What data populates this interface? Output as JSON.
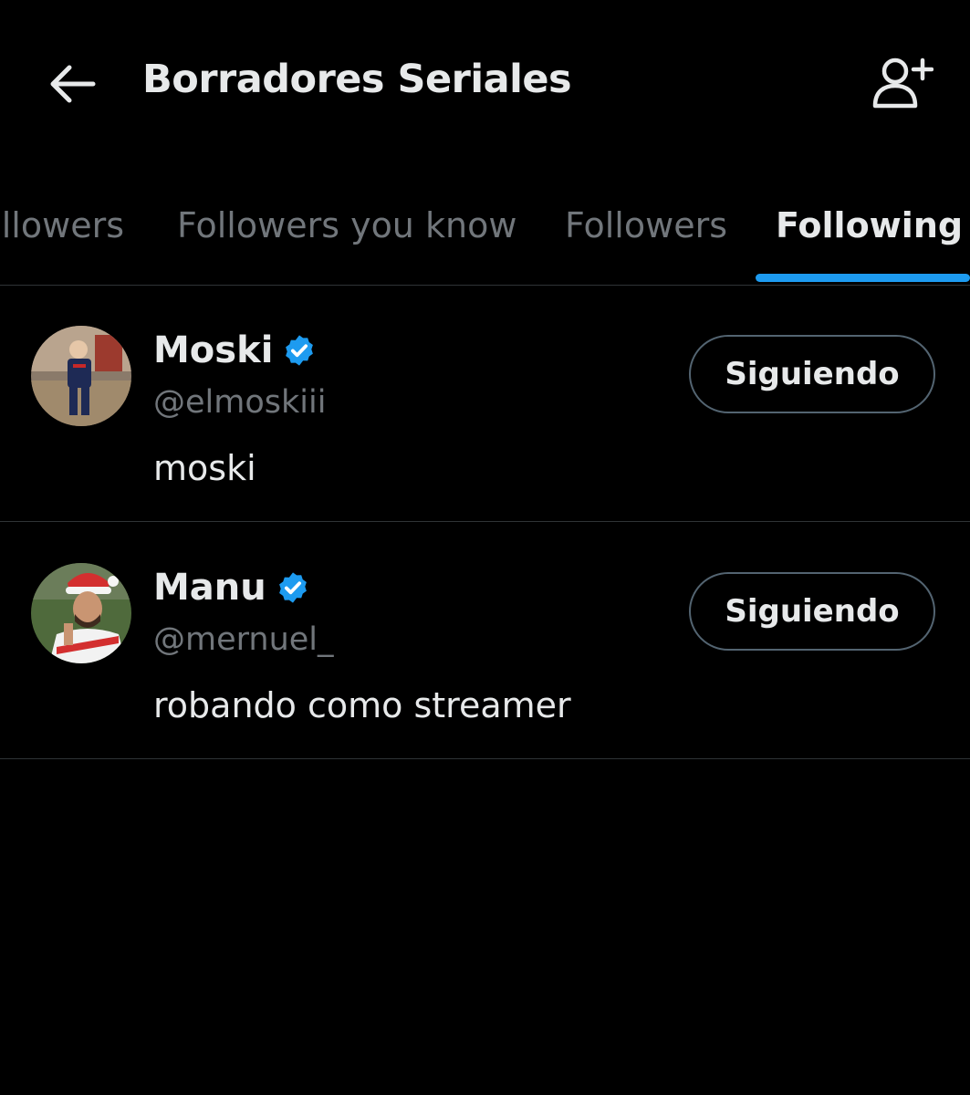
{
  "header": {
    "title": "Borradores Seriales",
    "back_icon": "arrow-left-icon",
    "add_user_icon": "person-plus-icon"
  },
  "tabs": [
    {
      "label": "Followers",
      "active": false
    },
    {
      "label": "Followers you know",
      "active": false
    },
    {
      "label": "Followers",
      "active": false
    },
    {
      "label": "Following",
      "active": true
    }
  ],
  "users": [
    {
      "name": "Moski",
      "verified": true,
      "handle": "@elmoskiii",
      "bio": "moski",
      "button_label": "Siguiendo"
    },
    {
      "name": "Manu",
      "verified": true,
      "handle": "@mernuel_",
      "bio": "robando como streamer",
      "button_label": "Siguiendo"
    }
  ],
  "colors": {
    "background": "#000000",
    "accent": "#1d9bf0",
    "text_primary": "#e7e9ea",
    "text_secondary": "#71767b",
    "border": "#2f3336"
  }
}
